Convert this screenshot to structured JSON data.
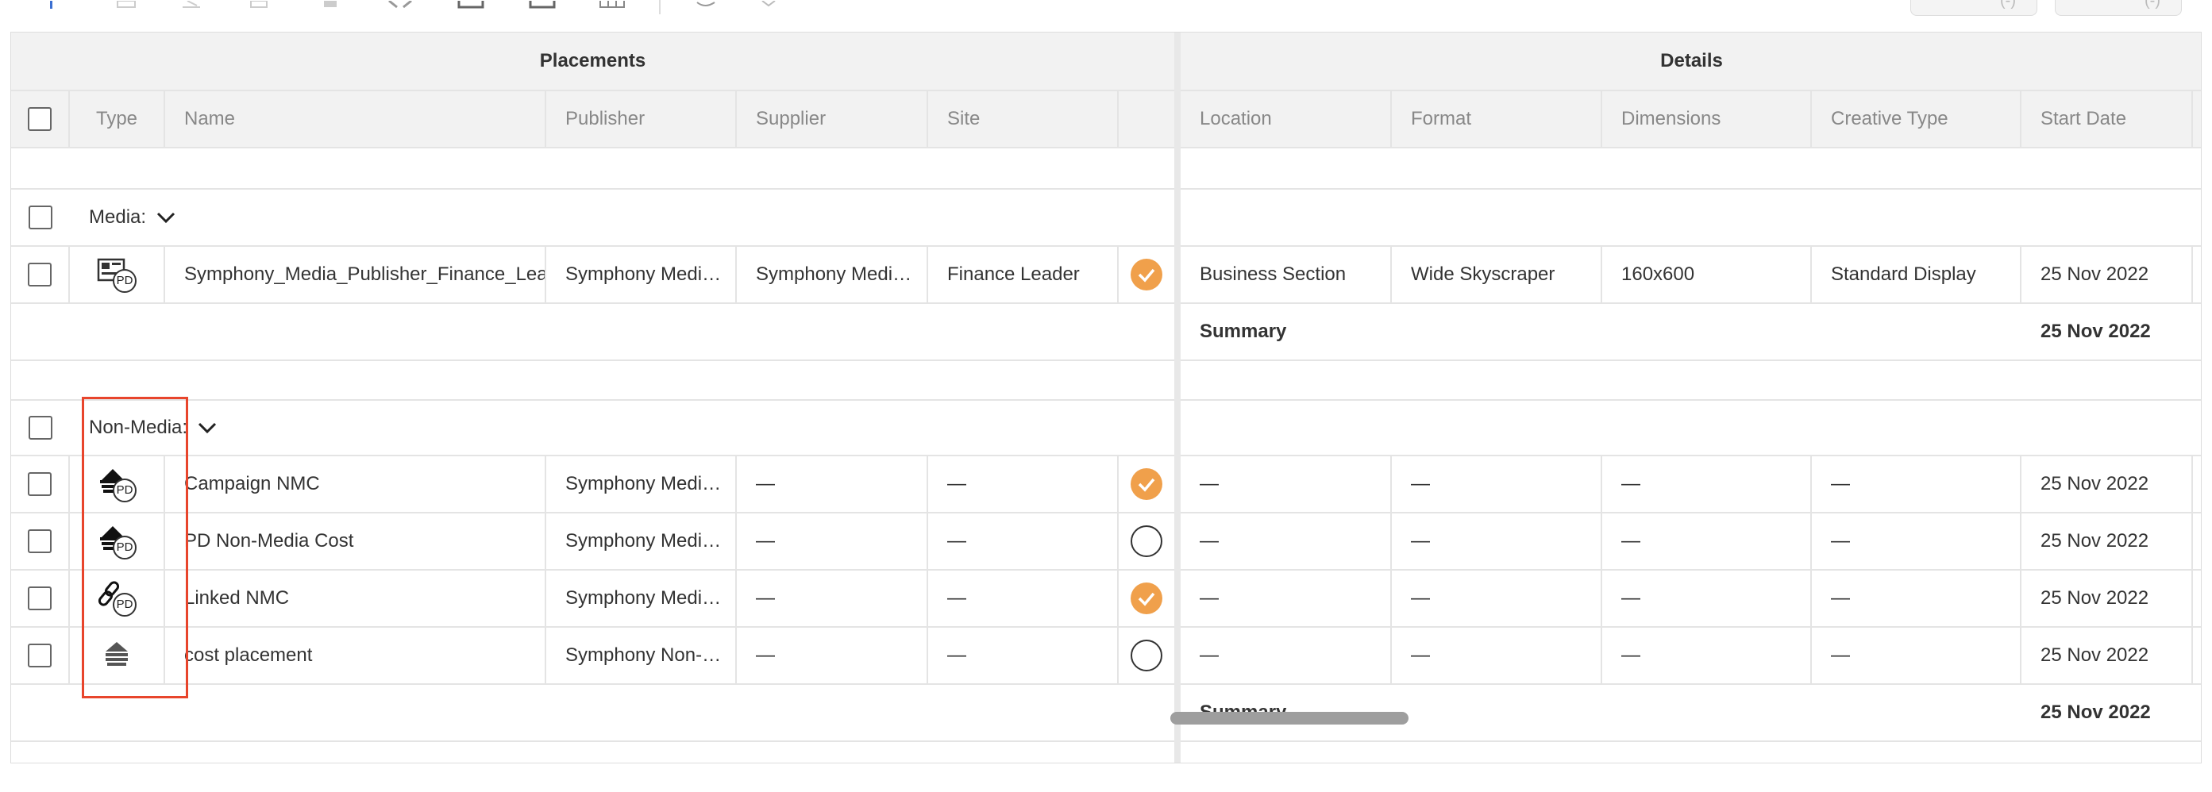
{
  "toolbar": {
    "icons": [
      "add-icon",
      "document-icon",
      "edit-icon",
      "copy-icon",
      "delete-icon",
      "close-icon",
      "export-icon",
      "import-icon",
      "grid-icon",
      "layers-icon",
      "chevron-down-icon"
    ],
    "buttons": [
      {
        "label": "(-)"
      },
      {
        "label": "(-)"
      }
    ]
  },
  "grid": {
    "groups": {
      "left": "Placements",
      "right": "Details"
    },
    "columns": {
      "type": "Type",
      "name": "Name",
      "publisher": "Publisher",
      "supplier": "Supplier",
      "site": "Site",
      "location": "Location",
      "format": "Format",
      "dimensions": "Dimensions",
      "creative_type": "Creative Type",
      "start_date": "Start Date"
    },
    "sections": [
      {
        "label": "Media:",
        "rows": [
          {
            "type_icon": "display-pd-icon",
            "name": "Symphony_Media_Publisher_Finance_Lead",
            "publisher": "Symphony Medi…",
            "supplier": "Symphony Medi…",
            "site": "Finance Leader",
            "status": "complete",
            "location": "Business Section",
            "format": "Wide Skyscraper",
            "dimensions": "160x600",
            "creative_type": "Standard Display",
            "start_date": "25 Nov 2022"
          }
        ],
        "summary": {
          "label": "Summary",
          "start_date": "25 Nov 2022"
        }
      },
      {
        "label": "Non-Media:",
        "rows": [
          {
            "type_icon": "cost-pd-icon",
            "name": "Campaign NMC",
            "publisher": "Symphony Medi…",
            "supplier": "—",
            "site": "—",
            "status": "complete",
            "location": "—",
            "format": "—",
            "dimensions": "—",
            "creative_type": "—",
            "start_date": "25 Nov 2022"
          },
          {
            "type_icon": "cost-pd-icon",
            "name": "PD Non-Media Cost",
            "publisher": "Symphony Medi…",
            "supplier": "—",
            "site": "—",
            "status": "incomplete",
            "location": "—",
            "format": "—",
            "dimensions": "—",
            "creative_type": "—",
            "start_date": "25 Nov 2022"
          },
          {
            "type_icon": "linked-pd-icon",
            "name": "Linked NMC",
            "publisher": "Symphony Medi…",
            "supplier": "—",
            "site": "—",
            "status": "complete",
            "location": "—",
            "format": "—",
            "dimensions": "—",
            "creative_type": "—",
            "start_date": "25 Nov 2022"
          },
          {
            "type_icon": "cost-icon",
            "name": "cost placement",
            "publisher": "Symphony Non-…",
            "supplier": "—",
            "site": "—",
            "status": "incomplete",
            "location": "—",
            "format": "—",
            "dimensions": "—",
            "creative_type": "—",
            "start_date": "25 Nov 2022"
          }
        ],
        "summary": {
          "label": "Summary",
          "start_date": "25 Nov 2022"
        }
      }
    ],
    "pd_badge": "PD"
  },
  "colors": {
    "accent": "#f0a04b",
    "highlight": "#e8452c",
    "header_bg": "#f2f2f2"
  }
}
